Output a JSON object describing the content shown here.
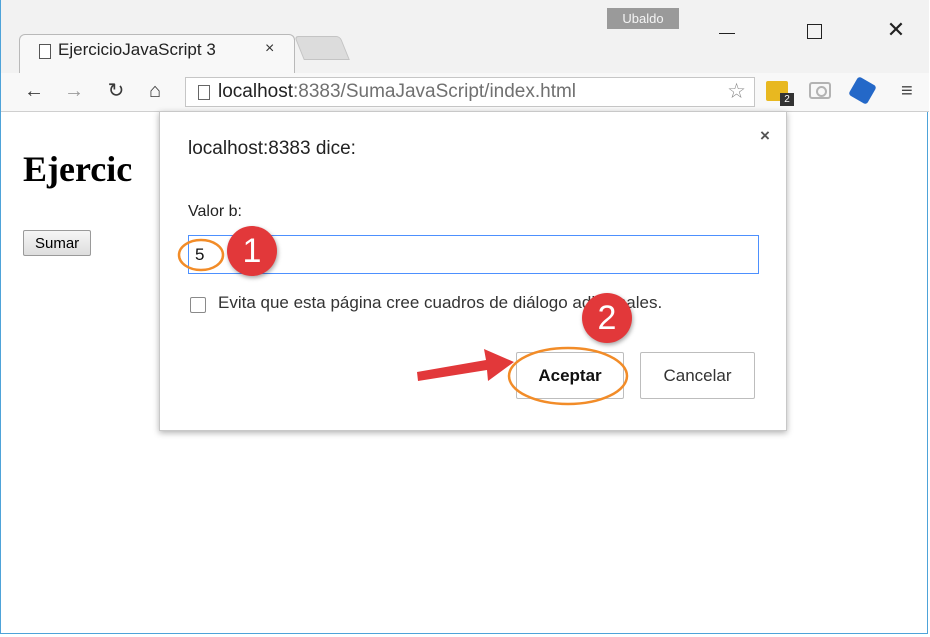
{
  "browser": {
    "user_badge": "Ubaldo",
    "tab_title": "EjercicioJavaScript 3",
    "tab_close": "×",
    "url_host": "localhost",
    "url_path": ":8383/SumaJavaScript/index.html",
    "menu_glyph": "≡",
    "extension_badge": "2"
  },
  "page": {
    "heading": "Ejercic",
    "button_label": "Sumar"
  },
  "dialog": {
    "title": "localhost:8383 dice:",
    "close": "×",
    "label": "Valor b:",
    "input_value": "5",
    "checkbox_label": "Evita que esta página cree cuadros de diálogo adicionales.",
    "accept_label": "Aceptar",
    "cancel_label": "Cancelar"
  },
  "annotations": {
    "step1": "1",
    "step2": "2",
    "highlight_color": "#f28c28",
    "marker_color": "#e2383a"
  }
}
